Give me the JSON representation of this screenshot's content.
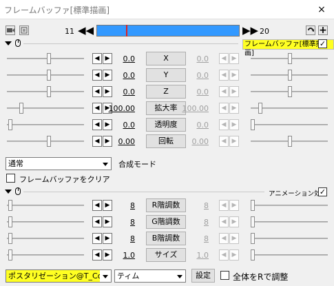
{
  "window": {
    "title": "フレームバッファ[標準描画]",
    "close": "×"
  },
  "toolbar": {
    "frame_start": "11",
    "frame_end": "20",
    "nav_prev": "◀◀",
    "nav_next": "▶▶",
    "plus": "+"
  },
  "section1": {
    "header_label": "フレームバッファ[標準描画]",
    "checked": true
  },
  "params": [
    {
      "name": "X",
      "left": "0.0",
      "right": "0.0"
    },
    {
      "name": "Y",
      "left": "0.0",
      "right": "0.0"
    },
    {
      "name": "Z",
      "left": "0.0",
      "right": "0.0"
    },
    {
      "name": "拡大率",
      "left": "100.00",
      "right": "100.00"
    },
    {
      "name": "透明度",
      "left": "0.0",
      "right": "0.0"
    },
    {
      "name": "回転",
      "left": "0.00",
      "right": "0.00"
    }
  ],
  "blend": {
    "mode_value": "通常",
    "mode_label": "合成モード"
  },
  "clear_buffer": {
    "label": "フレームバッファをクリア",
    "checked": false
  },
  "section2": {
    "header_label": "アニメーション効果",
    "checked": true
  },
  "anim_params": [
    {
      "name": "R階調数",
      "left": "8",
      "right": "8"
    },
    {
      "name": "G階調数",
      "left": "8",
      "right": "8"
    },
    {
      "name": "B階調数",
      "left": "8",
      "right": "8"
    },
    {
      "name": "サイズ",
      "left": "1.0",
      "right": "1.0"
    }
  ],
  "bottom": {
    "effect_value": "ポスタリゼーション@T_Color_",
    "group_value": "ティム",
    "settings_label": "設定",
    "adjust_label": "全体をRで調整",
    "adjust_checked": false
  },
  "spin": {
    "dec": "◀",
    "inc": "▶"
  },
  "colors": {
    "accent": "#3399ff",
    "highlight": "#ffff22",
    "cursor": "#dd2222"
  }
}
